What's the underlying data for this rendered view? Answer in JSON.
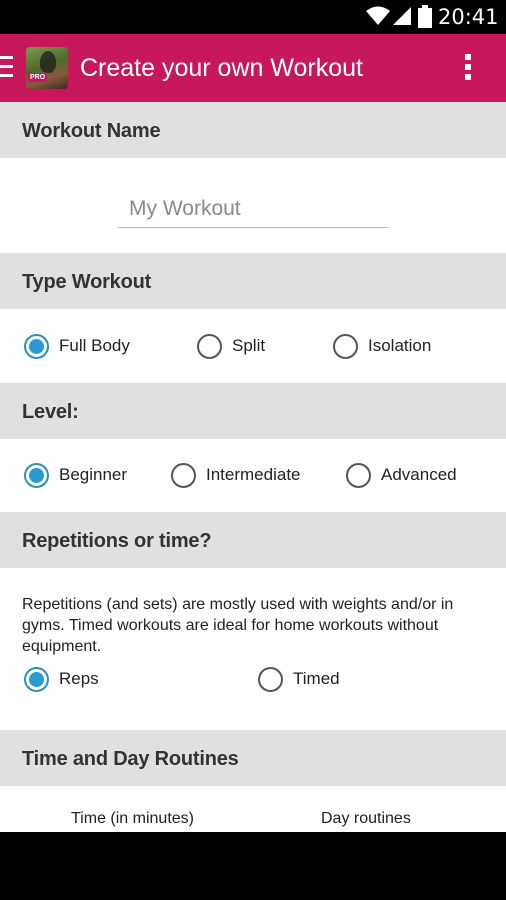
{
  "status_bar": {
    "time": "20:41"
  },
  "action_bar": {
    "badge": "PRO",
    "title": "Create your own Workout"
  },
  "sections": {
    "workout_name": {
      "label": "Workout Name",
      "placeholder": "My Workout"
    },
    "type_workout": {
      "label": "Type Workout",
      "options": [
        "Full Body",
        "Split",
        "Isolation"
      ],
      "selected": "Full Body"
    },
    "level": {
      "label": "Level:",
      "options": [
        "Beginner",
        "Intermediate",
        "Advanced"
      ],
      "selected": "Beginner"
    },
    "reps_or_time": {
      "label": "Repetitions or time?",
      "description": "Repetitions (and sets) are mostly used with weights and/or in gyms. Timed workouts are ideal for home workouts without equipment.",
      "options": [
        "Reps",
        "Timed"
      ],
      "selected": "Reps"
    },
    "time_day": {
      "label": "Time and Day Routines",
      "col1": "Time (in minutes)",
      "col2": "Day routines"
    }
  },
  "colors": {
    "accent": "#c8185c",
    "radio_checked": "#2a9bd0",
    "header_bg": "#e0e0e0"
  }
}
